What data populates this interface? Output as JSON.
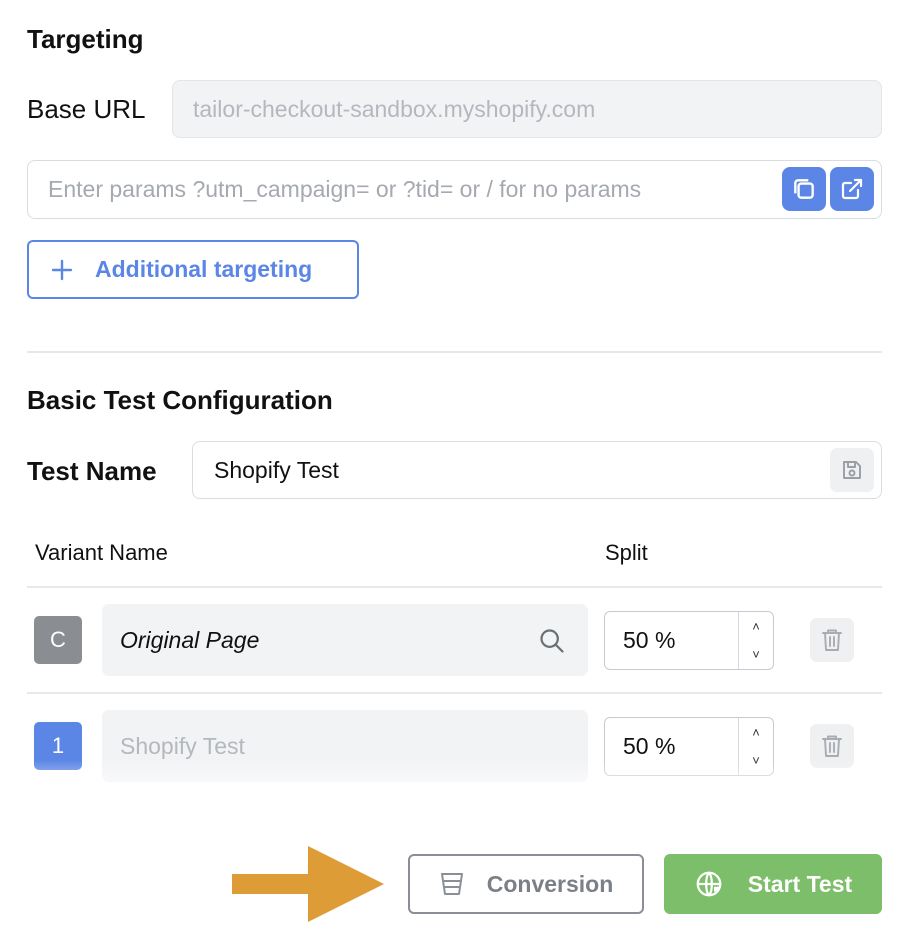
{
  "targeting": {
    "title": "Targeting",
    "base_url_label": "Base URL",
    "base_url_value": "tailor-checkout-sandbox.myshopify.com",
    "params_placeholder": "Enter params ?utm_campaign= or ?tid= or / for no params",
    "copy_icon": "copy-icon",
    "open_icon": "external-link-icon",
    "additional_targeting_label": "Additional targeting",
    "additional_targeting_icon": "plus-icon"
  },
  "config": {
    "title": "Basic Test Configuration",
    "test_name_label": "Test Name",
    "test_name_value": "Shopify Test",
    "save_icon": "save-icon",
    "columns": {
      "variant_name": "Variant Name",
      "split": "Split"
    },
    "variants": [
      {
        "badge": "C",
        "badge_color": "#8a8d92",
        "name": "Original Page",
        "split": "50 %"
      },
      {
        "badge": "1",
        "badge_color": "#5b86e5",
        "placeholder": "Shopify Test",
        "split": "50 %"
      }
    ],
    "spin_up": "˄",
    "spin_down": "˅"
  },
  "footer": {
    "conversion_label": "Conversion",
    "start_label": "Start Test",
    "start_color": "#7cbe6a",
    "arrow_color": "#de9c36"
  }
}
